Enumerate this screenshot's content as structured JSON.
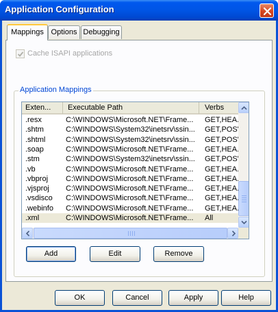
{
  "window": {
    "title": "Application Configuration"
  },
  "tabs": [
    {
      "label": "Mappings",
      "active": true
    },
    {
      "label": "Options",
      "active": false
    },
    {
      "label": "Debugging",
      "active": false
    }
  ],
  "mappings": {
    "cache_checkbox": {
      "label": "Cache ISAPI applications",
      "checked": true,
      "enabled": false
    },
    "group_label": "Application Mappings",
    "columns": [
      "Exten...",
      "Executable Path",
      "Verbs"
    ],
    "rows": [
      {
        "ext": ".resx",
        "path": "C:\\WINDOWS\\Microsoft.NET\\Frame...",
        "verbs": "GET,HEA..."
      },
      {
        "ext": ".shtm",
        "path": "C:\\WINDOWS\\System32\\inetsrv\\ssin...",
        "verbs": "GET,POS'"
      },
      {
        "ext": ".shtml",
        "path": "C:\\WINDOWS\\System32\\inetsrv\\ssin...",
        "verbs": "GET,POS'"
      },
      {
        "ext": ".soap",
        "path": "C:\\WINDOWS\\Microsoft.NET\\Frame...",
        "verbs": "GET,HEA..."
      },
      {
        "ext": ".stm",
        "path": "C:\\WINDOWS\\System32\\inetsrv\\ssin...",
        "verbs": "GET,POS'"
      },
      {
        "ext": ".vb",
        "path": "C:\\WINDOWS\\Microsoft.NET\\Frame...",
        "verbs": "GET,HEA..."
      },
      {
        "ext": ".vbproj",
        "path": "C:\\WINDOWS\\Microsoft.NET\\Frame...",
        "verbs": "GET,HEA..."
      },
      {
        "ext": ".vjsproj",
        "path": "C:\\WINDOWS\\Microsoft.NET\\Frame...",
        "verbs": "GET,HEA..."
      },
      {
        "ext": ".vsdisco",
        "path": "C:\\WINDOWS\\Microsoft.NET\\Frame...",
        "verbs": "GET,HEA..."
      },
      {
        "ext": ".webinfo",
        "path": "C:\\WINDOWS\\Microsoft.NET\\Frame...",
        "verbs": "GET,HEA..."
      },
      {
        "ext": ".xml",
        "path": "C:\\WINDOWS\\Microsoft.NET\\Frame...",
        "verbs": "All",
        "selected": true
      }
    ],
    "buttons": {
      "add": "Add",
      "edit": "Edit",
      "remove": "Remove"
    }
  },
  "footer": {
    "ok": "OK",
    "cancel": "Cancel",
    "apply": "Apply",
    "help": "Help"
  },
  "colors": {
    "titlebar": "#0054e3",
    "dialog_bg": "#ece9d8",
    "tab_panel_bg": "#fcfcfe",
    "group_label": "#0046d5",
    "active_tab_accent": "#ffc83c",
    "close_button": "#d6461f"
  },
  "icons": {
    "close": "close-x-icon",
    "scroll_up": "arrow-up-icon",
    "scroll_down": "arrow-down-icon",
    "scroll_left": "arrow-left-icon",
    "scroll_right": "arrow-right-icon"
  }
}
